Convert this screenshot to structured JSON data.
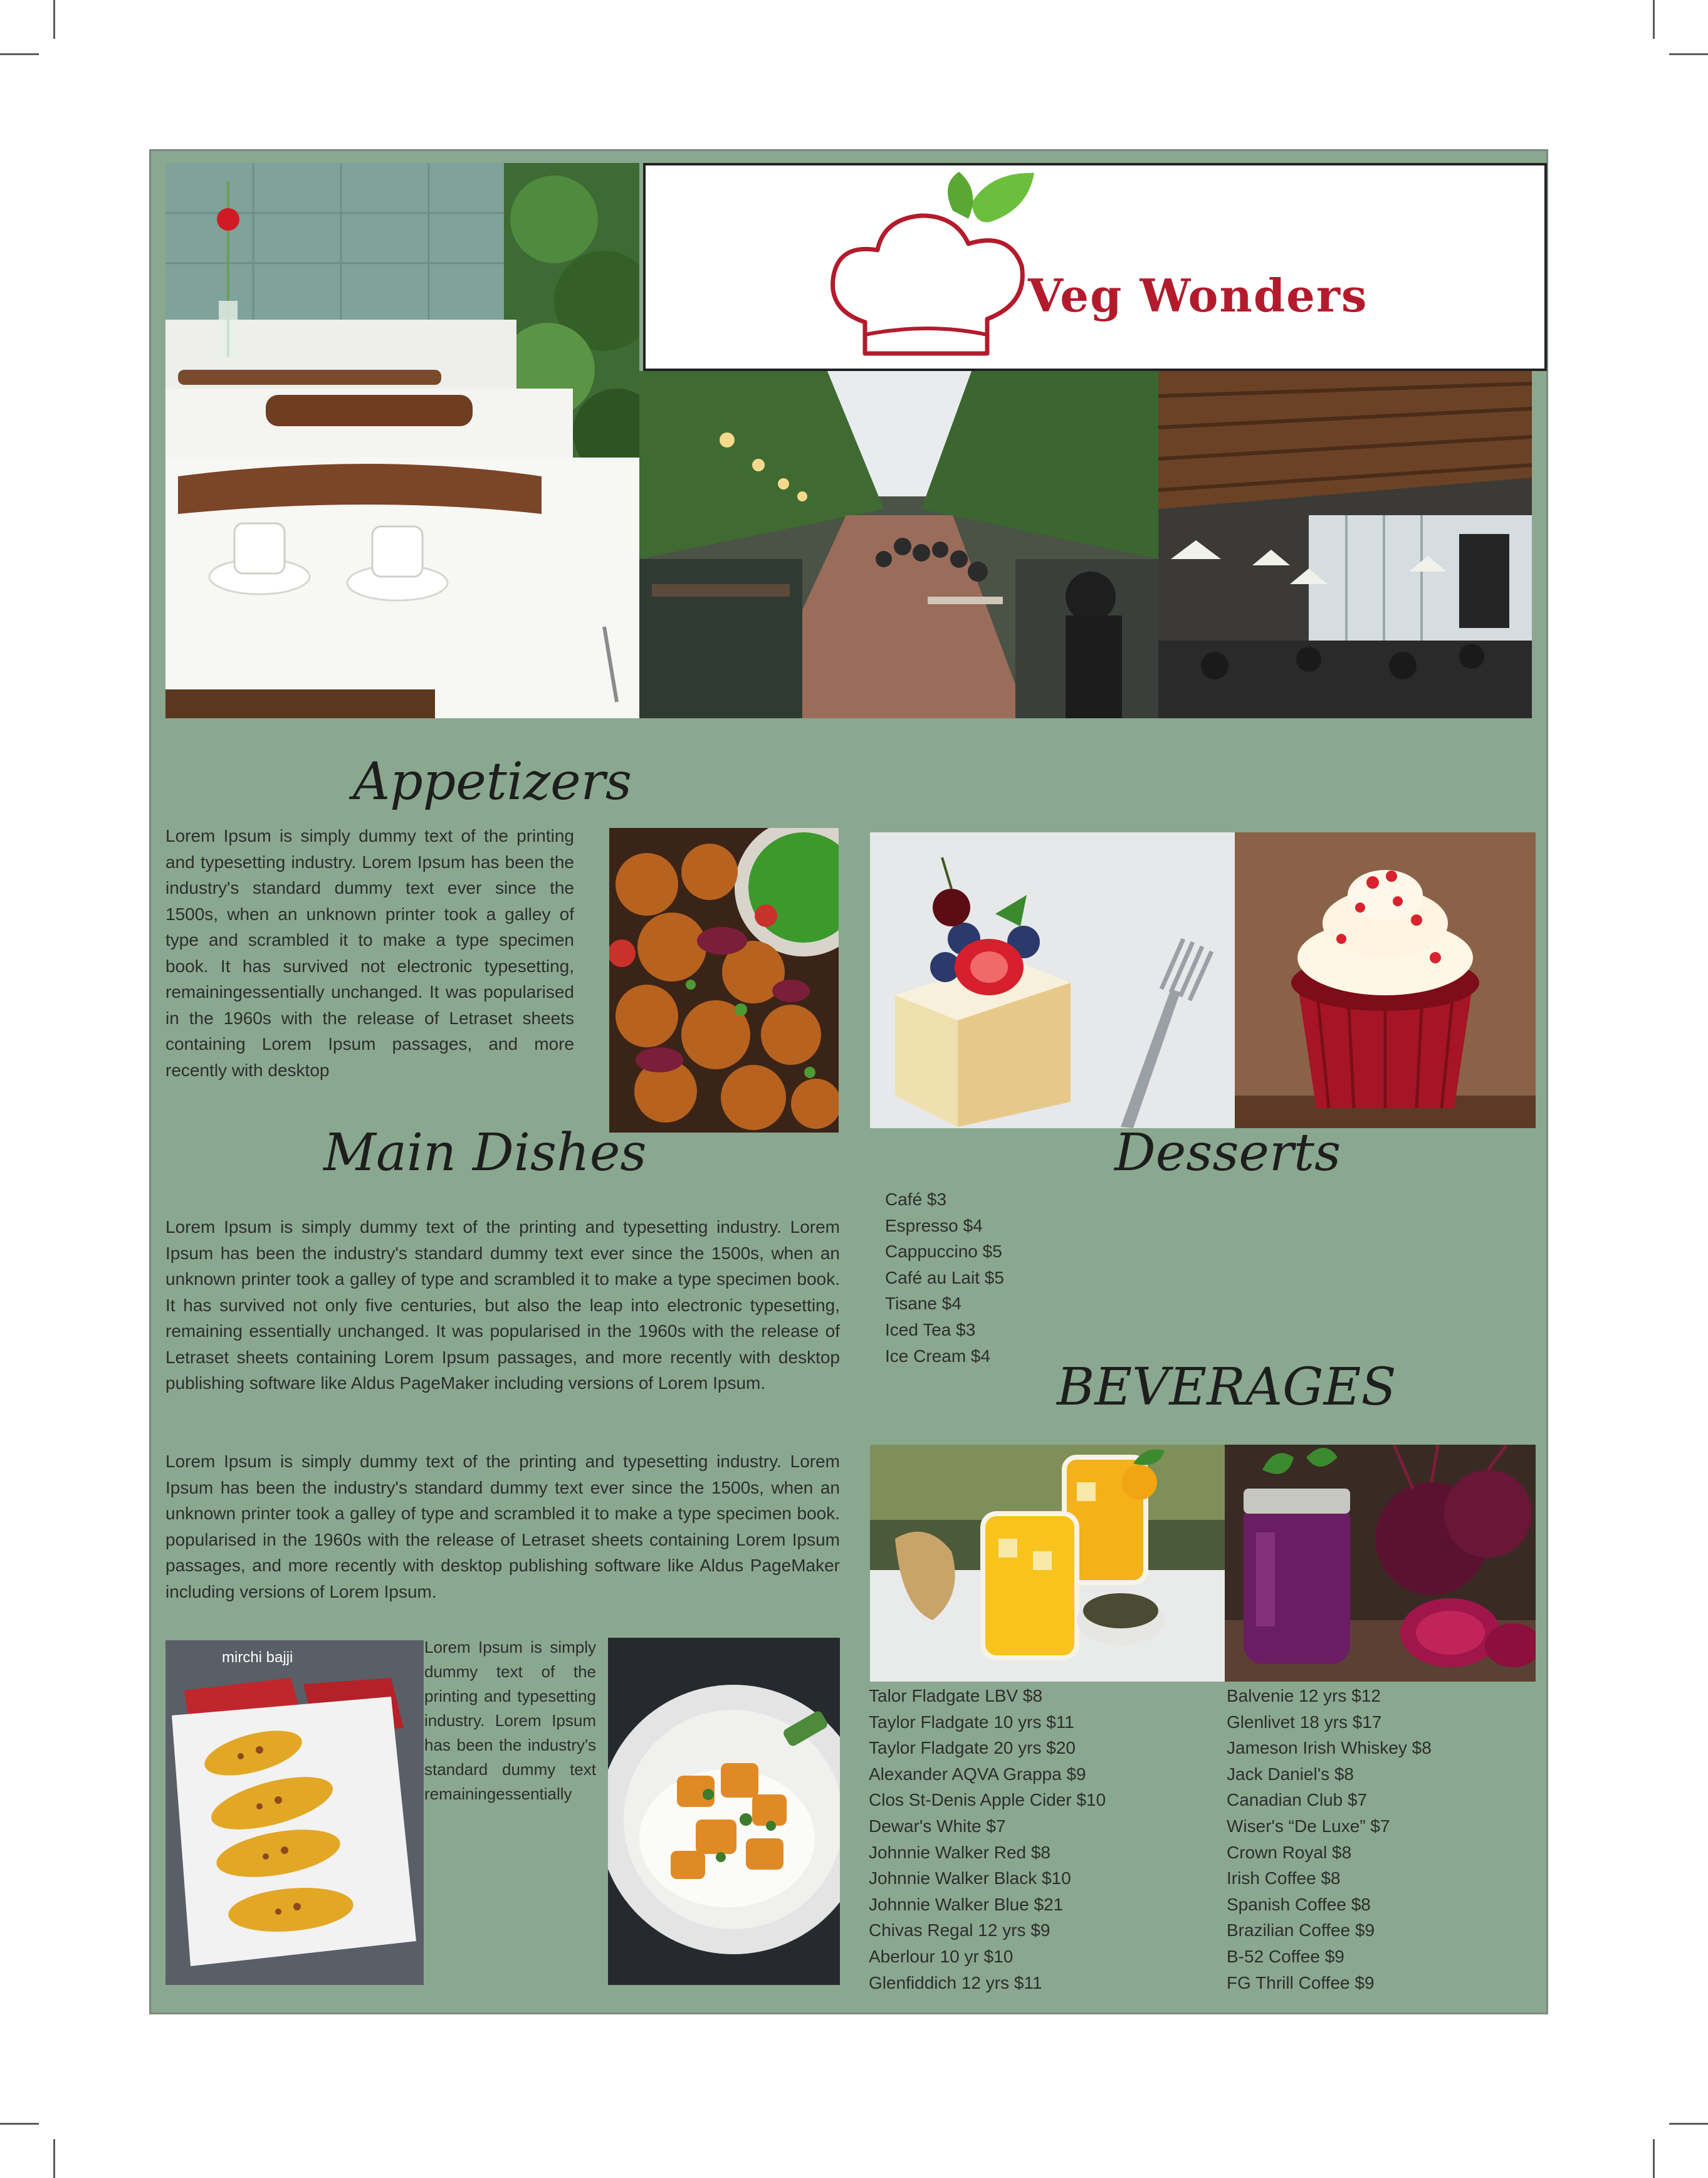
{
  "brand": {
    "name": "Veg Wonders",
    "colors": {
      "panel": "#8aa88f",
      "brand_red": "#b31b2c",
      "leaf_green": "#6cbf3c"
    }
  },
  "appetizers": {
    "title": "Appetizers",
    "text": "Lorem Ipsum is simply dummy text of the printing and typesetting industry. Lorem Ipsum has been the industry's standard dummy text ever since the 1500s, when an unknown printer took a galley of type and scrambled it to make a type specimen book. It has survived not electronic typesetting, remainingessentially unchanged. It was popularised in the 1960s with the release of Letraset sheets containing Lorem Ipsum passages, and more recently with desktop"
  },
  "main_dishes": {
    "title": "Main Dishes",
    "para1": "Lorem Ipsum is simply dummy text of the printing and typesetting industry. Lorem Ipsum has been the industry's standard dummy text ever since the 1500s, when an unknown printer took a galley of type and scrambled it to make a type specimen book. It has survived not only five centuries, but also the leap into electronic typesetting, remaining essentially unchanged. It was popularised in the 1960s with the release of Letraset sheets containing Lorem Ipsum passages, and more recently with desktop publishing software like Aldus PageMaker including versions of Lorem Ipsum.",
    "para2": "Lorem Ipsum is simply dummy text of the printing and typesetting industry. Lorem Ipsum has been the industry's standard dummy text ever since the 1500s, when an unknown printer took a galley of type and scrambled it to make a type specimen book. popularised in the 1960s with the release of Letraset sheets containing Lorem Ipsum passages, and more recently with desktop publishing software like Aldus PageMaker including versions of Lorem Ipsum.",
    "side_text": "Lorem Ipsum is simply dummy text of the printing and typesetting industry. Lorem Ipsum has been the industry's standard dummy text remainingessentially",
    "photo_caption": "mirchi bajji"
  },
  "desserts": {
    "title": "Desserts",
    "items": [
      "Café $3",
      "Espresso $4",
      "Cappuccino $5",
      "Café au Lait $5",
      "Tisane $4",
      "Iced Tea $3",
      "Ice Cream $4"
    ]
  },
  "beverages": {
    "title": "BEVERAGES",
    "col1": [
      "Talor Fladgate LBV $8",
      "Taylor Fladgate 10 yrs $11",
      "Taylor Fladgate 20 yrs $20",
      "Alexander AQVA Grappa $9",
      "Clos St-Denis Apple Cider $10",
      "Dewar's White $7",
      "Johnnie Walker Red $8",
      "Johnnie Walker Black $10",
      "Johnnie Walker Blue $21",
      "Chivas Regal 12 yrs $9",
      "Aberlour 10 yr $10",
      "Glenfiddich 12 yrs $11"
    ],
    "col2": [
      "Balvenie 12 yrs $12",
      "Glenlivet 18 yrs $17",
      "Jameson Irish Whiskey $8",
      "Jack Daniel's $8",
      "Canadian Club $7",
      "Wiser's “De Luxe” $7",
      "Crown Royal $8",
      "Irish Coffee $8",
      "Spanish Coffee $8",
      "Brazilian Coffee $9",
      "B-52 Coffee $9",
      "FG Thrill Coffee $9"
    ]
  }
}
